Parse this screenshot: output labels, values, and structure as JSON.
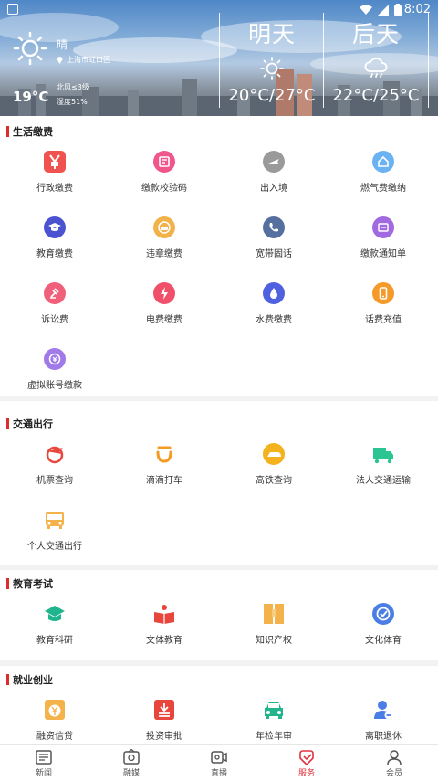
{
  "status_bar": {
    "time": "8:02"
  },
  "weather": {
    "today": {
      "condition": "晴",
      "location": "上海市虹口区",
      "temperature": "19°C",
      "wind": "北风≤3级",
      "humidity": "湿度51%",
      "icon": "sun-icon"
    },
    "forecast": [
      {
        "day": "明天",
        "temp": "20°C/27°C",
        "icon": "sun-icon"
      },
      {
        "day": "后天",
        "temp": "22°C/25°C",
        "icon": "cloud-rain-icon"
      }
    ]
  },
  "sections": {
    "living": {
      "title": "生活缴费",
      "items": [
        {
          "label": "行政缴费",
          "icon": "yen-icon",
          "color": "#f0534f"
        },
        {
          "label": "缴款校验码",
          "icon": "receipt-icon",
          "color": "#f0558c"
        },
        {
          "label": "出入境",
          "icon": "plane-icon",
          "color": "#9a9a9a"
        },
        {
          "label": "燃气费缴纳",
          "icon": "house-icon",
          "color": "#6bb2f2"
        },
        {
          "label": "教育缴费",
          "icon": "graduation-cap-icon",
          "color": "#4b53d0"
        },
        {
          "label": "违章缴费",
          "icon": "car-icon",
          "color": "#f2b24a"
        },
        {
          "label": "宽带固话",
          "icon": "phone-icon",
          "color": "#55709e"
        },
        {
          "label": "缴款通知单",
          "icon": "notice-icon",
          "color": "#a16ae0"
        },
        {
          "label": "诉讼费",
          "icon": "gavel-icon",
          "color": "#f0607a"
        },
        {
          "label": "电费缴费",
          "icon": "lightning-icon",
          "color": "#f0506a"
        },
        {
          "label": "水费缴费",
          "icon": "water-drop-icon",
          "color": "#5061e0"
        },
        {
          "label": "话费充值",
          "icon": "mobile-icon",
          "color": "#f59a2a"
        },
        {
          "label": "虚拟账号缴款",
          "icon": "account-icon",
          "color": "#a07ae8"
        }
      ]
    },
    "transport": {
      "title": "交通出行",
      "items": [
        {
          "label": "机票查询",
          "icon": "globe-plane-icon",
          "color": "#e8453c"
        },
        {
          "label": "滴滴打车",
          "icon": "didi-icon",
          "color": "#f59a22"
        },
        {
          "label": "高铁查询",
          "icon": "train-icon",
          "color": "#f3b21e"
        },
        {
          "label": "法人交通运输",
          "icon": "truck-icon",
          "color": "#2bc493"
        },
        {
          "label": "个人交通出行",
          "icon": "bus-icon",
          "color": "#f3b24a"
        }
      ]
    },
    "education": {
      "title": "教育考试",
      "items": [
        {
          "label": "教育科研",
          "icon": "mortarboard-icon",
          "color": "#21b58e"
        },
        {
          "label": "文体教育",
          "icon": "book-person-icon",
          "color": "#e8453c"
        },
        {
          "label": "知识产权",
          "icon": "documents-icon",
          "color": "#f3b24a"
        },
        {
          "label": "文化体育",
          "icon": "badge-check-icon",
          "color": "#4a7ee6"
        }
      ]
    },
    "employment": {
      "title": "就业创业",
      "items": [
        {
          "label": "融资信贷",
          "icon": "money-bag-icon",
          "color": "#f3b24a"
        },
        {
          "label": "投资审批",
          "icon": "approval-icon",
          "color": "#e8453c"
        },
        {
          "label": "年检年审",
          "icon": "car-inspection-icon",
          "color": "#21b58e"
        },
        {
          "label": "离职退休",
          "icon": "person-minus-icon",
          "color": "#4a7ee6"
        }
      ]
    }
  },
  "bottom_nav": [
    {
      "label": "新闻",
      "icon": "news-icon",
      "active": false
    },
    {
      "label": "融媒",
      "icon": "media-icon",
      "active": false
    },
    {
      "label": "直播",
      "icon": "live-camera-icon",
      "active": false
    },
    {
      "label": "服务",
      "icon": "service-icon",
      "active": true
    },
    {
      "label": "会员",
      "icon": "member-icon",
      "active": false
    }
  ],
  "colors": {
    "accent": "#e0343c",
    "section_bar": "#e02b2b"
  }
}
